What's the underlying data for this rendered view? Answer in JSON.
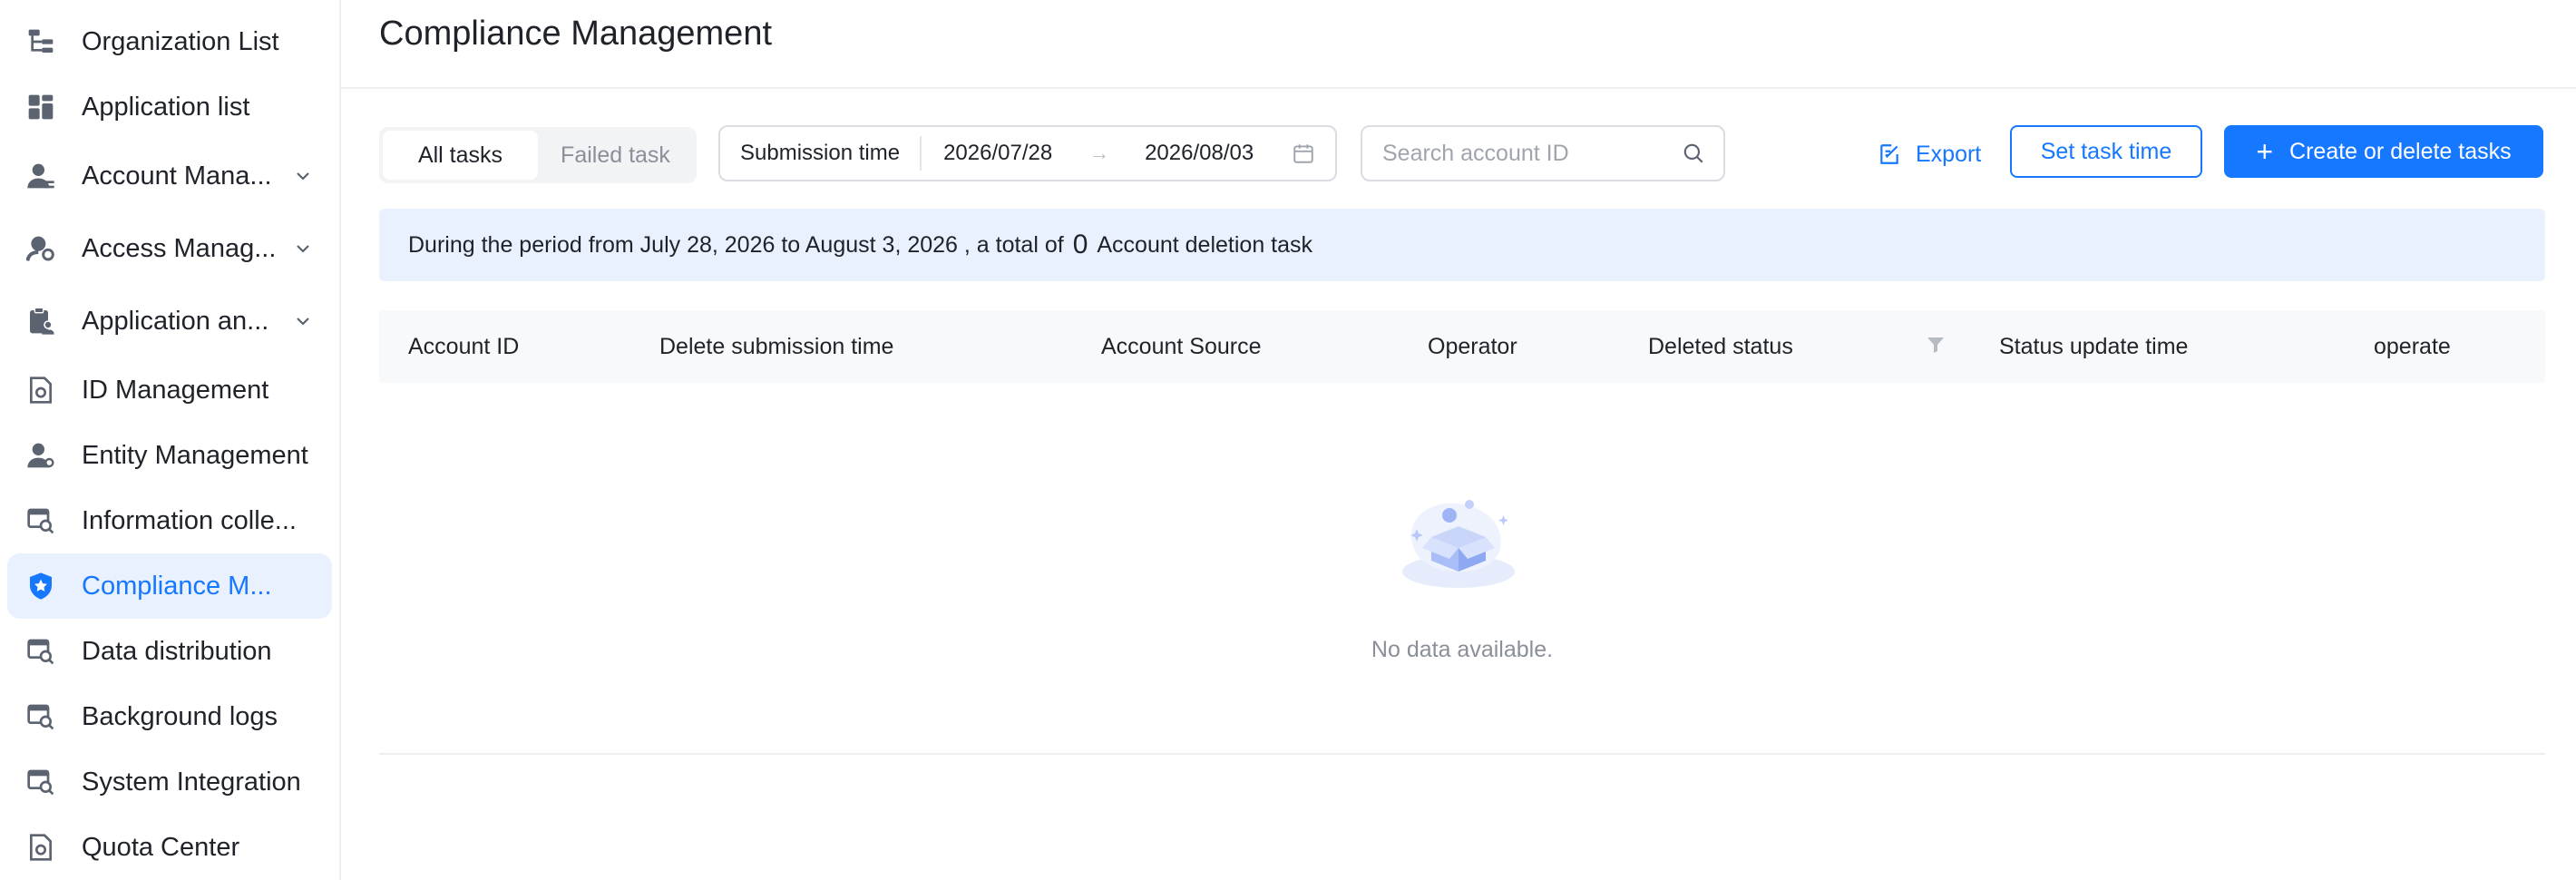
{
  "sidebar": {
    "items": [
      {
        "label": "Organization List",
        "icon": "org-tree-icon"
      },
      {
        "label": "Application list",
        "icon": "grid-apps-icon"
      },
      {
        "label": "Account Mana...",
        "icon": "account-icon",
        "expandable": true
      },
      {
        "label": "Access Manag...",
        "icon": "access-icon",
        "expandable": true
      },
      {
        "label": "Application an...",
        "icon": "clipboard-user-icon",
        "expandable": true
      },
      {
        "label": "ID Management",
        "icon": "id-doc-icon"
      },
      {
        "label": "Entity Management",
        "icon": "entity-icon"
      },
      {
        "label": "Information colle...",
        "icon": "info-search-icon"
      },
      {
        "label": "Compliance M...",
        "icon": "shield-star-icon",
        "active": true
      },
      {
        "label": "Data distribution",
        "icon": "data-search-icon"
      },
      {
        "label": "Background logs",
        "icon": "logs-search-icon"
      },
      {
        "label": "System Integration",
        "icon": "integration-search-icon"
      },
      {
        "label": "Quota Center",
        "icon": "quota-doc-icon"
      }
    ]
  },
  "header": {
    "title": "Compliance Management"
  },
  "toolbar": {
    "tabs": [
      {
        "label": "All tasks",
        "selected": true
      },
      {
        "label": "Failed task",
        "selected": false
      }
    ],
    "range_label": "Submission time",
    "start_date": "2026/07/28",
    "range_arrow": "→",
    "end_date": "2026/08/03",
    "search_placeholder": "Search account ID",
    "export_label": "Export",
    "set_time_label": "Set task time",
    "create_plus": "+",
    "create_label": "Create or delete tasks"
  },
  "notice": {
    "prefix": "During the period from July 28, 2026 to August 3, 2026 , a total of",
    "count": "0",
    "suffix": "Account deletion task"
  },
  "table": {
    "columns": [
      "Account ID",
      "Delete submission time",
      "Account Source",
      "Operator",
      "Deleted status",
      "Status update time",
      "operate"
    ],
    "rows": [],
    "empty_text": "No data available."
  },
  "colors": {
    "accent": "#1677ff",
    "active_bg": "#e8f1fd",
    "icon_gray": "#5b6270"
  }
}
